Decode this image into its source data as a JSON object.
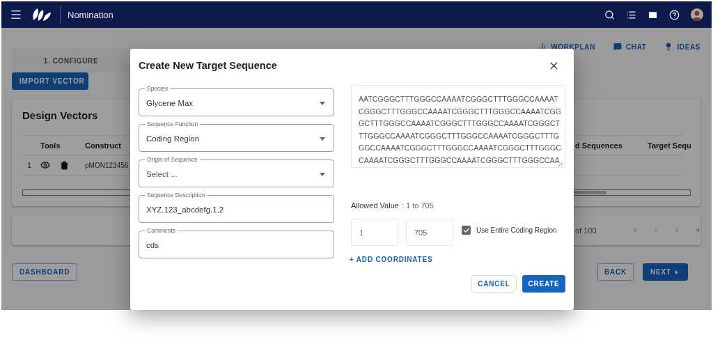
{
  "header": {
    "title": "Nomination"
  },
  "top_links": [
    {
      "kind": "workplan",
      "label": "WORKPLAN"
    },
    {
      "kind": "chat",
      "label": "CHAT"
    },
    {
      "kind": "ideas",
      "label": "IDEAS"
    }
  ],
  "step_tab": {
    "label": "1. CONFIGURE"
  },
  "import_button": "IMPORT VECTOR",
  "design_vectors": {
    "title": "Design Vectors",
    "columns": [
      "Tools",
      "Construct",
      "d Sequences",
      "Target Sequ"
    ],
    "rows": [
      {
        "index": "1",
        "construct": "pMON123456"
      }
    ]
  },
  "pagination": {
    "range": "of 100"
  },
  "footer": {
    "dashboard": "DASHBOARD",
    "back": "BACK",
    "next": "NEXT"
  },
  "dialog": {
    "title": "Create New Target Sequence",
    "fields": [
      {
        "kind": "select",
        "label": "Species",
        "value": "Glycene Max"
      },
      {
        "kind": "select",
        "label": "Sequence Function",
        "value": "Coding Region"
      },
      {
        "kind": "select",
        "label": "Origin of Sequence",
        "placeholder": "Select ..."
      },
      {
        "kind": "text",
        "label": "Sequence Description",
        "value": "XYZ.123_abcdefg.1.2"
      },
      {
        "kind": "text",
        "label": "Comments",
        "value": "cds"
      }
    ],
    "sequence": [
      "AATCGGGCTTTGGGCCAAAATCGGGCTTTGGGCCAAAAT",
      "CGGGCTTTGGGCCAAAATCGGGCTTTGGGCCAAAATCGG",
      "GCTTTGGGCCAAAATCGGGCTTTGGGCCAAAATCGGGCT",
      "TTGGGCCAAAATCGGGCTTTGGGCCAAAATCGGGCTTTG",
      "GGCCAAAATCGGGCTTTGGGCCAAAATCGGGCTTTGGGC",
      "CAAAATCGGGCTTTGGGCCAAAATCGGGCTTTGGGCCAA"
    ],
    "allowed_label": "Allowed Value",
    "allowed_range": ": 1 to 705",
    "start": "1",
    "end": "705",
    "use_entire": {
      "label": "Use Entire Coding Region",
      "checked": true
    },
    "add_coordinates": "+ ADD COORDINATES",
    "cancel": "CANCEL",
    "create": "CREATE"
  }
}
